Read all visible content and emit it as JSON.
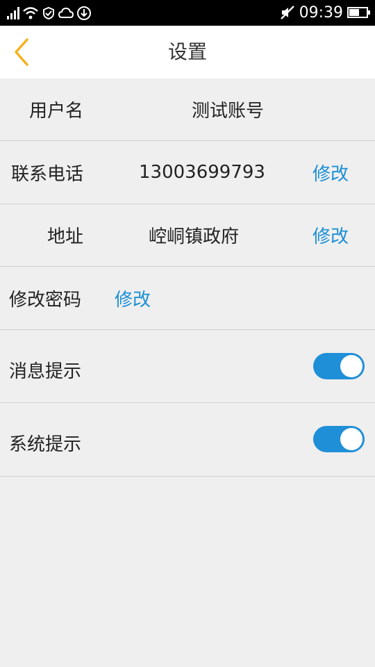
{
  "status_bar": {
    "time": "09:39",
    "icons": [
      "signal-icon",
      "wifi-icon",
      "shield-icon",
      "cloud-icon",
      "download-icon",
      "mute-icon",
      "battery-icon"
    ],
    "battery_level": 0.5
  },
  "nav": {
    "title": "设置",
    "back_icon": "chevron-left-icon",
    "accent_color": "#f5b21c"
  },
  "rows": {
    "username": {
      "label": "用户名",
      "value": "测试账号"
    },
    "phone": {
      "label": "联系电话",
      "value": "13003699793",
      "action": "修改"
    },
    "address": {
      "label": "地址",
      "value": "崆峒镇政府",
      "action": "修改"
    },
    "password": {
      "label": "修改密码",
      "action": "修改"
    },
    "message_notice": {
      "label": "消息提示",
      "enabled": true
    },
    "system_notice": {
      "label": "系统提示",
      "enabled": true
    }
  },
  "colors": {
    "link": "#1a8fd6",
    "toggle_on": "#1f8fd8",
    "background": "#efefef"
  }
}
